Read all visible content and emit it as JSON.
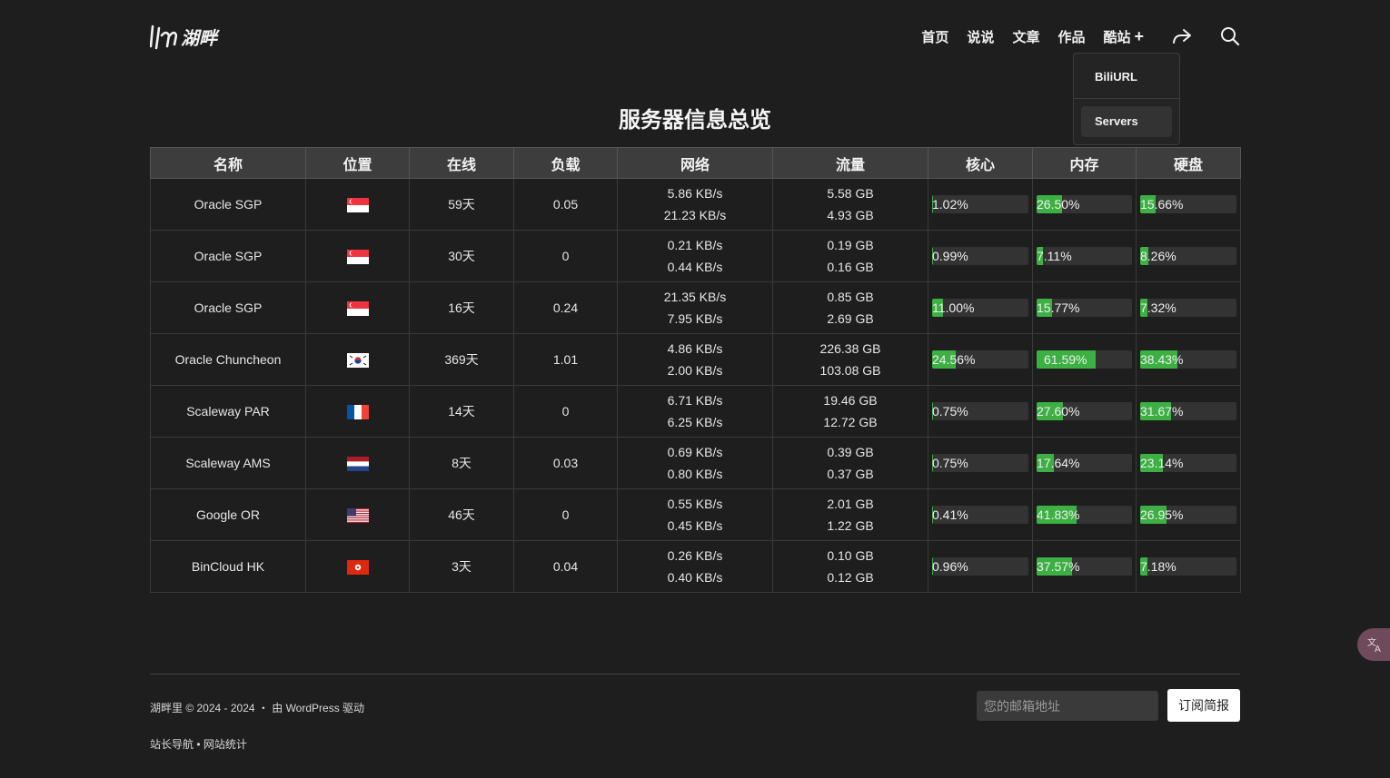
{
  "brand": {
    "logo_text": "湖畔"
  },
  "nav": {
    "items": [
      "首页",
      "说说",
      "文章",
      "作品",
      "酷站"
    ],
    "plus": "+",
    "dropdown": [
      "BiliURL",
      "Servers"
    ]
  },
  "page": {
    "title": "服务器信息总览"
  },
  "table": {
    "headers": [
      "名称",
      "位置",
      "在线",
      "负载",
      "网络",
      "流量",
      "核心",
      "内存",
      "硬盘"
    ],
    "rows": [
      {
        "name": "Oracle SGP",
        "flag": "sg",
        "uptime": "59天",
        "load": "0.05",
        "net_up": "5.86 KB/s",
        "net_down": "21.23 KB/s",
        "traffic_up": "5.58 GB",
        "traffic_down": "4.93 GB",
        "cpu": "1.02%",
        "cpu_v": 1.02,
        "mem": "26.50%",
        "mem_v": 26.5,
        "disk": "15.66%",
        "disk_v": 15.66
      },
      {
        "name": "Oracle SGP",
        "flag": "sg",
        "uptime": "30天",
        "load": "0",
        "net_up": "0.21 KB/s",
        "net_down": "0.44 KB/s",
        "traffic_up": "0.19 GB",
        "traffic_down": "0.16 GB",
        "cpu": "0.99%",
        "cpu_v": 0.99,
        "mem": "7.11%",
        "mem_v": 7.11,
        "disk": "8.26%",
        "disk_v": 8.26
      },
      {
        "name": "Oracle SGP",
        "flag": "sg",
        "uptime": "16天",
        "load": "0.24",
        "net_up": "21.35 KB/s",
        "net_down": "7.95 KB/s",
        "traffic_up": "0.85 GB",
        "traffic_down": "2.69 GB",
        "cpu": "11.00%",
        "cpu_v": 11.0,
        "mem": "15.77%",
        "mem_v": 15.77,
        "disk": "7.32%",
        "disk_v": 7.32
      },
      {
        "name": "Oracle Chuncheon",
        "flag": "kr",
        "uptime": "369天",
        "load": "1.01",
        "net_up": "4.86 KB/s",
        "net_down": "2.00 KB/s",
        "traffic_up": "226.38 GB",
        "traffic_down": "103.08 GB",
        "cpu": "24.56%",
        "cpu_v": 24.56,
        "mem": "61.59%",
        "mem_v": 61.59,
        "disk": "38.43%",
        "disk_v": 38.43
      },
      {
        "name": "Scaleway PAR",
        "flag": "fr",
        "uptime": "14天",
        "load": "0",
        "net_up": "6.71 KB/s",
        "net_down": "6.25 KB/s",
        "traffic_up": "19.46 GB",
        "traffic_down": "12.72 GB",
        "cpu": "0.75%",
        "cpu_v": 0.75,
        "mem": "27.60%",
        "mem_v": 27.6,
        "disk": "31.67%",
        "disk_v": 31.67
      },
      {
        "name": "Scaleway AMS",
        "flag": "nl",
        "uptime": "8天",
        "load": "0.03",
        "net_up": "0.69 KB/s",
        "net_down": "0.80 KB/s",
        "traffic_up": "0.39 GB",
        "traffic_down": "0.37 GB",
        "cpu": "0.75%",
        "cpu_v": 0.75,
        "mem": "17.64%",
        "mem_v": 17.64,
        "disk": "23.14%",
        "disk_v": 23.14
      },
      {
        "name": "Google OR",
        "flag": "us",
        "uptime": "46天",
        "load": "0",
        "net_up": "0.55 KB/s",
        "net_down": "0.45 KB/s",
        "traffic_up": "2.01 GB",
        "traffic_down": "1.22 GB",
        "cpu": "0.41%",
        "cpu_v": 0.41,
        "mem": "41.83%",
        "mem_v": 41.83,
        "disk": "26.95%",
        "disk_v": 26.95
      },
      {
        "name": "BinCloud HK",
        "flag": "hk",
        "uptime": "3天",
        "load": "0.04",
        "net_up": "0.26 KB/s",
        "net_down": "0.40 KB/s",
        "traffic_up": "0.10 GB",
        "traffic_down": "0.12 GB",
        "cpu": "0.96%",
        "cpu_v": 0.96,
        "mem": "37.57%",
        "mem_v": 37.57,
        "disk": "7.18%",
        "disk_v": 7.18
      }
    ]
  },
  "footer": {
    "copyright": "湖畔里 © 2024 - 2024 ・ 由 WordPress 驱动",
    "links": [
      "站长导航",
      "网站统计"
    ],
    "link_sep": " • ",
    "email_placeholder": "您的邮箱地址",
    "subscribe_label": "订阅简报"
  },
  "colors": {
    "bar_fill": "#3cb043",
    "bar_track": "#333333",
    "accent": "#3cb043"
  },
  "icons": {
    "share": "share-icon",
    "search": "search-icon",
    "translate": "translate-icon"
  }
}
